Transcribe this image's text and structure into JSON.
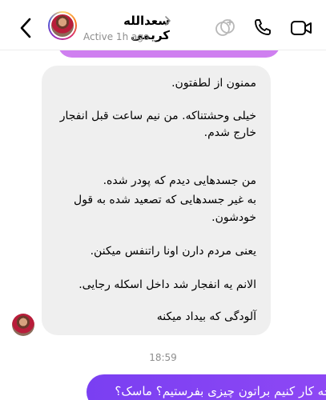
{
  "header": {
    "contact_name": "سعدالله کریمی",
    "status": "Active 1h ago",
    "icons": [
      "back-icon",
      "avatar",
      "chevron-right-icon",
      "effects-icon",
      "phone-icon",
      "video-call-icon"
    ]
  },
  "conversation": {
    "incoming_message": {
      "lines": [
        "ممنون از لطفتون.",
        "خیلی وحشتناکه. من نیم ساعت قبل انفجار",
        "خارج شدم.",
        "من جسدهایی دیدم که پودر شده.",
        "به غیر جسدهایی که تصعید شده به قول",
        "خودشون.",
        "یعنی مردم دارن اونا راتنفس میکنن.",
        "الانم یه انفجار شد داخل اسکله رجایی.",
        "آلودگی که بیداد میکنه"
      ]
    },
    "timestamp": "18:59",
    "outgoing_message": "چه کار کنیم براتون چیزی بفرستیم؟ ماسک؟"
  },
  "colors": {
    "incoming_bubble": "#efefef",
    "outgoing_bubble": "#8a44f4",
    "previous_outgoing_bubble": "#cf7ff0",
    "secondary_text": "#8e8e8e"
  }
}
